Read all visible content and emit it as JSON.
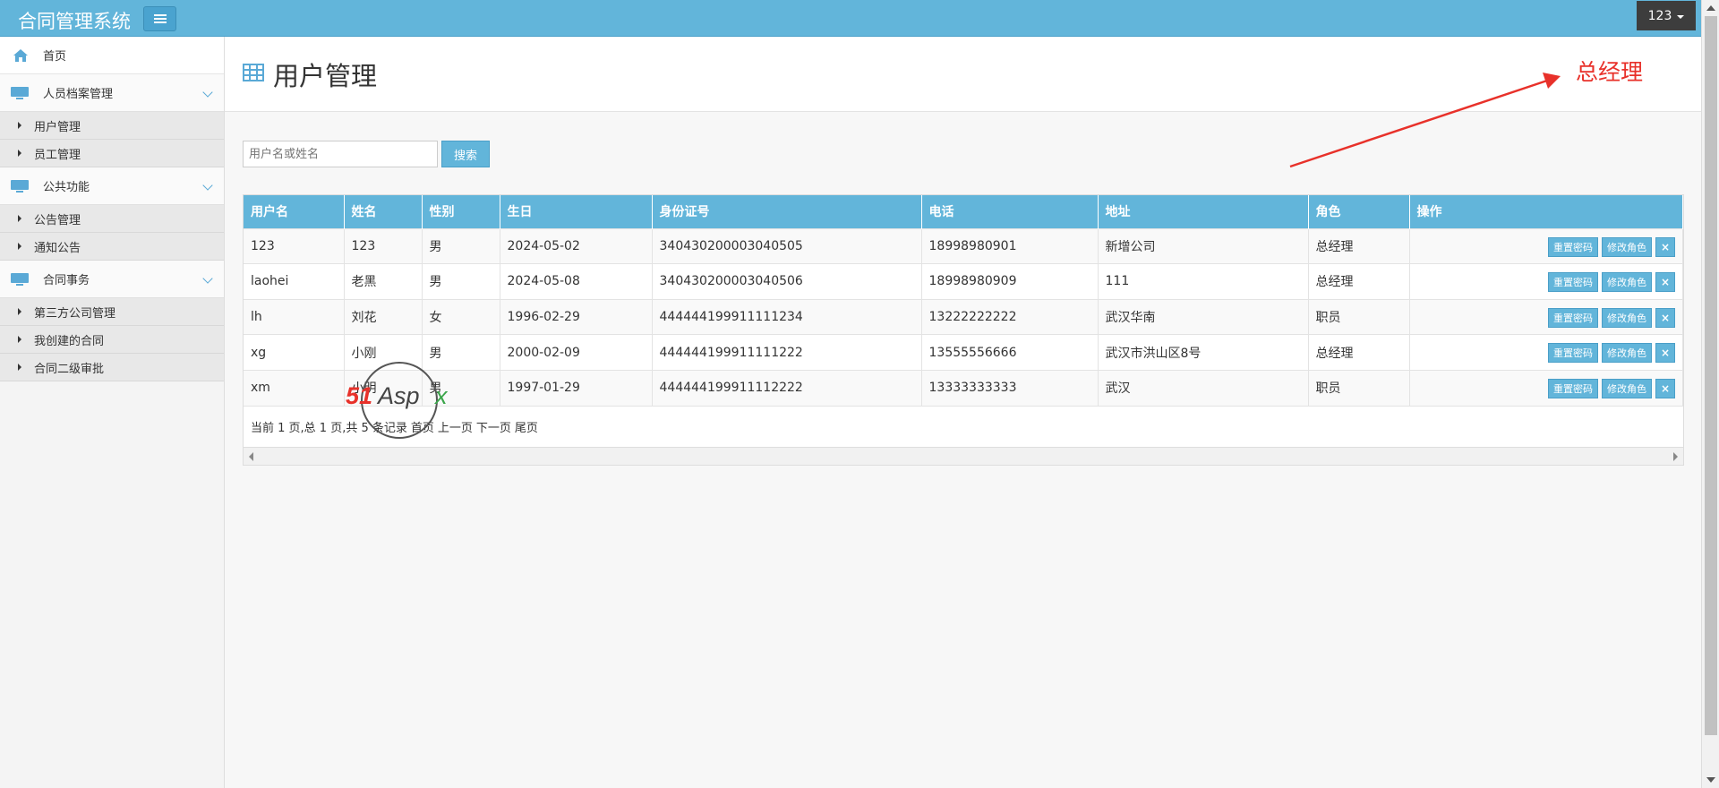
{
  "app": {
    "title": "合同管理系统",
    "user": "123"
  },
  "sidebar": {
    "home": "首页",
    "groups": [
      {
        "label": "人员档案管理",
        "items": [
          "用户管理",
          "员工管理"
        ]
      },
      {
        "label": "公共功能",
        "items": [
          "公告管理",
          "通知公告"
        ]
      },
      {
        "label": "合同事务",
        "items": [
          "第三方公司管理",
          "我创建的合同",
          "合同二级审批"
        ]
      }
    ]
  },
  "page": {
    "title": "用户管理",
    "role_note": "总经理"
  },
  "search": {
    "placeholder": "用户名或姓名",
    "button": "搜索"
  },
  "table": {
    "headers": [
      "用户名",
      "姓名",
      "性别",
      "生日",
      "身份证号",
      "电话",
      "地址",
      "角色",
      "操作"
    ],
    "rows": [
      [
        "123",
        "123",
        "男",
        "2024-05-02",
        "340430200003040505",
        "18998980901",
        "新增公司",
        "总经理"
      ],
      [
        "laohei",
        "老黑",
        "男",
        "2024-05-08",
        "340430200003040506",
        "18998980909",
        "111",
        "总经理"
      ],
      [
        "lh",
        "刘花",
        "女",
        "1996-02-29",
        "444444199911111234",
        "13222222222",
        "武汉华南",
        "职员"
      ],
      [
        "xg",
        "小刚",
        "男",
        "2000-02-09",
        "444444199911111222",
        "13555556666",
        "武汉市洪山区8号",
        "总经理"
      ],
      [
        "xm",
        "小明",
        "男",
        "1997-01-29",
        "444444199911112222",
        "13333333333",
        "武汉",
        "职员"
      ]
    ],
    "ops": {
      "reset": "重置密码",
      "edit_role": "修改角色",
      "delete": "×"
    }
  },
  "pager": {
    "text": "当前 1 页,总 1 页,共 5 条记录",
    "first": "首页",
    "prev": "上一页",
    "next": "下一页",
    "last": "尾页"
  },
  "watermark": {
    "text": "51Aspx"
  },
  "colors": {
    "primary": "#62b5da",
    "accent_red": "#e8312a"
  }
}
